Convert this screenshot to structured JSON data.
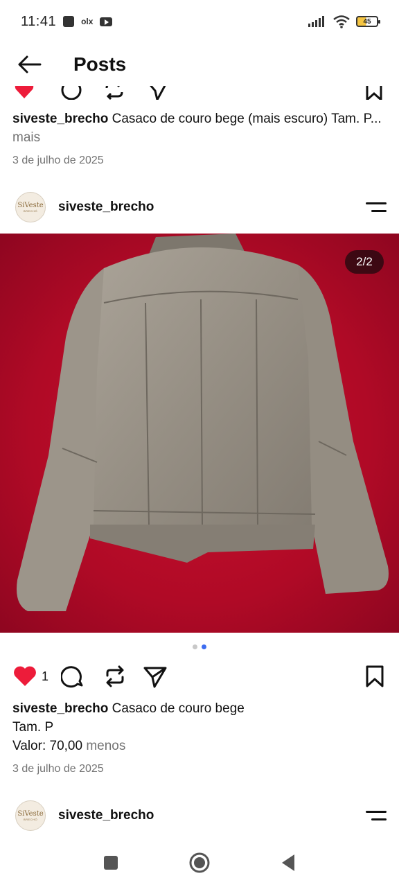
{
  "status": {
    "time": "11:41",
    "olx": "olx",
    "battery": "45"
  },
  "header": {
    "title": "Posts"
  },
  "posts": [
    {
      "caption_user": "siveste_brecho",
      "caption_text": " Casaco de couro bege (mais escuro) Tam. P...",
      "caption_more": " mais",
      "date": "3 de julho de 2025"
    },
    {
      "author": "siveste_brecho",
      "avatar_text": "SiVeste",
      "avatar_sub": "BRECHÓ",
      "counter": "2/2",
      "likes": "1",
      "caption_user": "siveste_brecho",
      "caption_line1": " Casaco de couro bege",
      "caption_line2": "Tam. P",
      "caption_line3": "Valor: 70,00",
      "caption_less": " menos",
      "date": "3 de julho de 2025"
    },
    {
      "author": "siveste_brecho",
      "avatar_text": "SiVeste",
      "avatar_sub": "BRECHÓ"
    }
  ],
  "colors": {
    "heart": "#ed1c3a",
    "dot_active": "#3d6cf0",
    "background_red": "#c8102e",
    "leather": "#9a948a"
  },
  "icons": {
    "back": "arrow-left-icon",
    "menu": "menu-icon",
    "like": "heart-icon",
    "comment": "comment-icon",
    "repost": "repost-icon",
    "share": "send-icon",
    "save": "bookmark-icon"
  }
}
